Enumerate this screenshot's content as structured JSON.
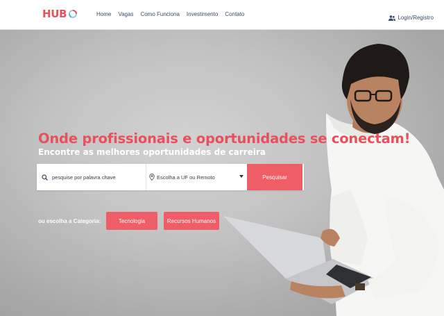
{
  "brand": {
    "logo_text": "HUB",
    "accent_color": "#e8505b",
    "logo_icon": "ring-icon"
  },
  "nav": {
    "items": [
      {
        "label": "Home"
      },
      {
        "label": "Vagas"
      },
      {
        "label": "Como Funciona"
      },
      {
        "label": "Investimento"
      },
      {
        "label": "Contato"
      }
    ],
    "login_label": "Login/Registro",
    "login_icon": "users-icon"
  },
  "hero": {
    "headline": "Onde profissionais e oportunidades se conectam!",
    "subheadline": "Encontre as melhores oportunidades de carreira"
  },
  "search": {
    "keyword_placeholder": "pesquise  por palavra chave",
    "location_value": "Escolha a UF ou Remoto",
    "button_label": "Pesquisar",
    "button_color": "#ef5d66"
  },
  "categories": {
    "label": "ou escolha a Categoria:",
    "items": [
      {
        "label": "Tecnologia"
      },
      {
        "label": "Recursos Humanos"
      }
    ]
  }
}
